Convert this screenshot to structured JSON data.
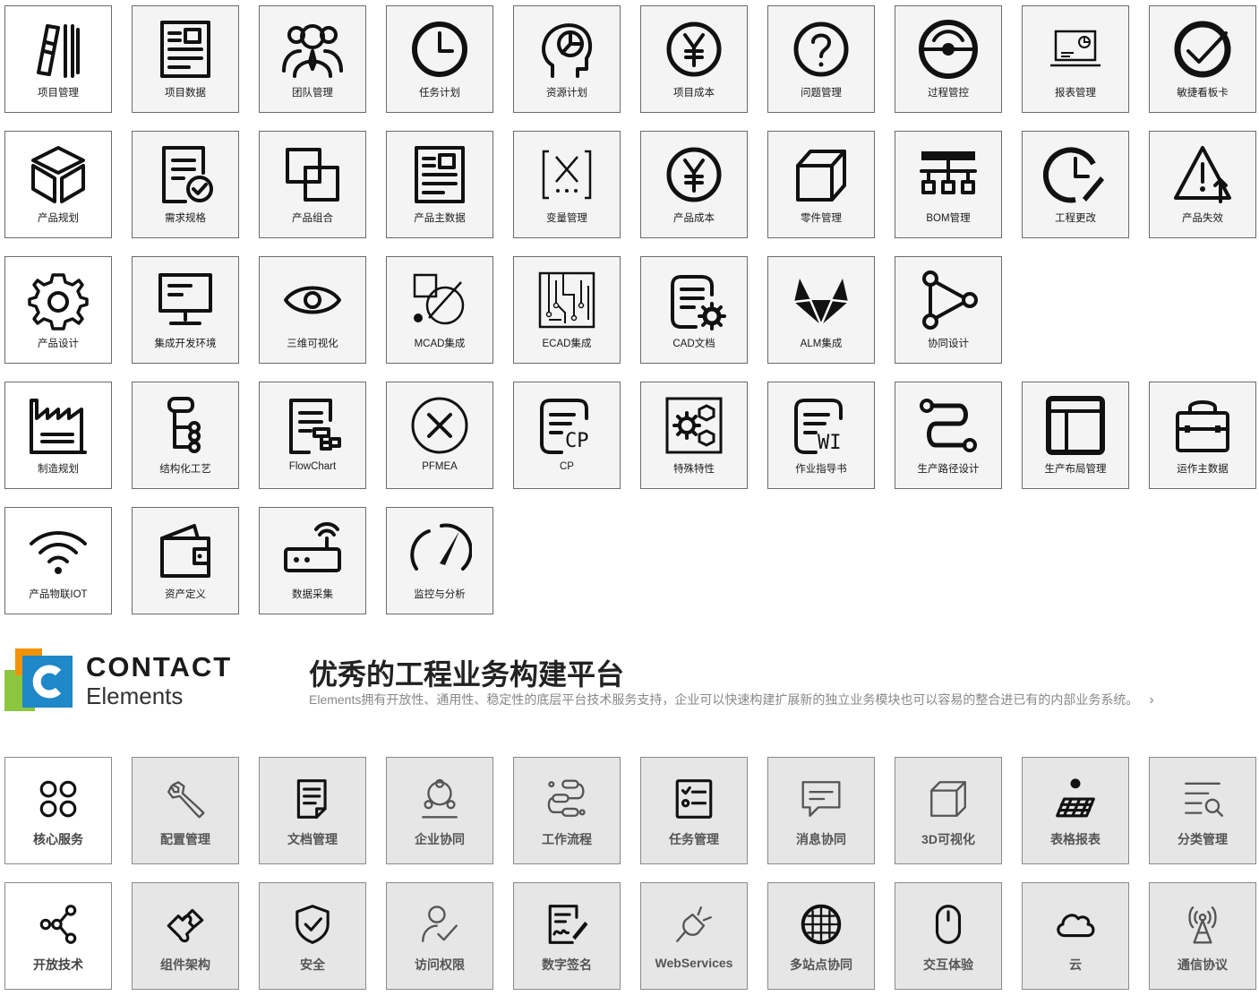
{
  "top_grid": [
    {
      "label": "项目管理",
      "icon": "project-management-icon"
    },
    {
      "label": "项目数据",
      "icon": "project-data-icon"
    },
    {
      "label": "团队管理",
      "icon": "team-icon"
    },
    {
      "label": "任务计划",
      "icon": "clock-icon"
    },
    {
      "label": "资源计划",
      "icon": "head-chart-icon"
    },
    {
      "label": "项目成本",
      "icon": "yen-icon"
    },
    {
      "label": "问题管理",
      "icon": "question-icon"
    },
    {
      "label": "过程管控",
      "icon": "gauge-icon"
    },
    {
      "label": "报表管理",
      "icon": "laptop-chart-icon"
    },
    {
      "label": "敏捷看板卡",
      "icon": "check-circle-icon"
    },
    {
      "label": "产品规划",
      "icon": "cube-open-icon"
    },
    {
      "label": "需求规格",
      "icon": "doc-check-icon"
    },
    {
      "label": "产品组合",
      "icon": "overlap-squares-icon"
    },
    {
      "label": "产品主数据",
      "icon": "product-data-icon"
    },
    {
      "label": "变量管理",
      "icon": "variable-icon"
    },
    {
      "label": "产品成本",
      "icon": "yen-icon"
    },
    {
      "label": "零件管理",
      "icon": "cube-icon"
    },
    {
      "label": "BOM管理",
      "icon": "bom-tree-icon"
    },
    {
      "label": "工程更改",
      "icon": "clock-pen-icon"
    },
    {
      "label": "产品失效",
      "icon": "warning-icon"
    },
    {
      "label": "产品设计",
      "icon": "gear-icon"
    },
    {
      "label": "集成开发环境",
      "icon": "monitor-icon"
    },
    {
      "label": "三维可视化",
      "icon": "eye-icon"
    },
    {
      "label": "MCAD集成",
      "icon": "mcad-shapes-icon"
    },
    {
      "label": "ECAD集成",
      "icon": "circuit-board-icon"
    },
    {
      "label": "CAD文档",
      "icon": "doc-gear-icon"
    },
    {
      "label": "ALM集成",
      "icon": "fox-icon"
    },
    {
      "label": "协同设计",
      "icon": "share-nodes-icon"
    },
    {
      "label": "",
      "icon": ""
    },
    {
      "label": "",
      "icon": ""
    },
    {
      "label": "制造规划",
      "icon": "factory-icon"
    },
    {
      "label": "结构化工艺",
      "icon": "structure-icon"
    },
    {
      "label": "FlowChart",
      "icon": "doc-flow-icon"
    },
    {
      "label": "PFMEA",
      "icon": "x-circle-icon"
    },
    {
      "label": "CP",
      "icon": "doc-cp-icon"
    },
    {
      "label": "特殊特性",
      "icon": "special-gears-icon"
    },
    {
      "label": "作业指导书",
      "icon": "doc-wi-icon"
    },
    {
      "label": "生产路径设计",
      "icon": "route-icon"
    },
    {
      "label": "生产布局管理",
      "icon": "layout-icon"
    },
    {
      "label": "运作主数据",
      "icon": "bag-icon"
    },
    {
      "label": "产品物联IOT",
      "icon": "wifi-icon"
    },
    {
      "label": "资产定义",
      "icon": "wallet-icon"
    },
    {
      "label": "数据采集",
      "icon": "router-icon"
    },
    {
      "label": "监控与分析",
      "icon": "speedometer-icon"
    }
  ],
  "banner": {
    "brand": "CONTACT",
    "brand_sub": "Elements",
    "headline": "优秀的工程业务构建平台",
    "description": "Elements拥有开放性、通用性、稳定性的底层平台技术服务支持，企业可以快速构建扩展新的独立业务模块也可以容易的整合进已有的内部业务系统。",
    "arrow": "›",
    "logo_colors": {
      "orange": "#f39200",
      "green": "#8cc63f",
      "blue": "#1e88c8"
    }
  },
  "bottom_grid": [
    {
      "label": "核心服务",
      "icon": "core-services-icon"
    },
    {
      "label": "配置管理",
      "icon": "wrench-icon"
    },
    {
      "label": "文档管理",
      "icon": "document-icon"
    },
    {
      "label": "企业协同",
      "icon": "network-icon"
    },
    {
      "label": "工作流程",
      "icon": "workflow-icon"
    },
    {
      "label": "任务管理",
      "icon": "task-list-icon"
    },
    {
      "label": "消息协同",
      "icon": "message-icon"
    },
    {
      "label": "3D可视化",
      "icon": "cube-3d-icon"
    },
    {
      "label": "表格报表",
      "icon": "table-icon"
    },
    {
      "label": "分类管理",
      "icon": "classify-icon"
    },
    {
      "label": "开放技术",
      "icon": "share-icon"
    },
    {
      "label": "组件架构",
      "icon": "puzzle-icon"
    },
    {
      "label": "安全",
      "icon": "shield-icon"
    },
    {
      "label": "访问权限",
      "icon": "user-check-icon"
    },
    {
      "label": "数字签名",
      "icon": "signature-icon"
    },
    {
      "label": "WebServices",
      "icon": "plug-icon"
    },
    {
      "label": "多站点协同",
      "icon": "globe-grid-icon"
    },
    {
      "label": "交互体验",
      "icon": "mouse-icon"
    },
    {
      "label": "云",
      "icon": "cloud-icon"
    },
    {
      "label": "通信协议",
      "icon": "antenna-icon"
    }
  ]
}
